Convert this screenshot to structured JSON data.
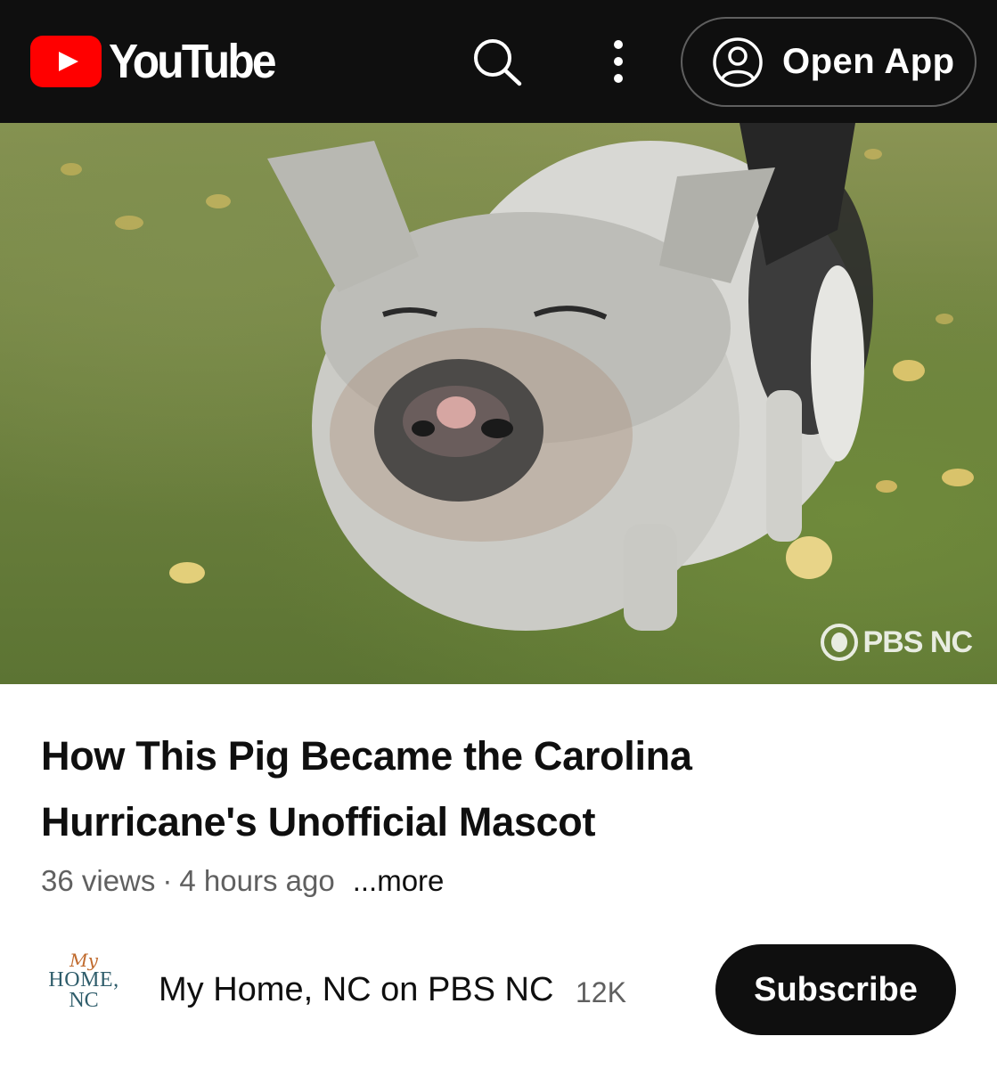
{
  "header": {
    "logo_text": "YouTube",
    "open_app_label": "Open App",
    "icons": {
      "logo": "youtube-play-icon",
      "search": "search-icon",
      "more": "more-vert-icon",
      "account": "account-circle-icon"
    }
  },
  "video": {
    "thumbnail_description_icon": "video-thumbnail",
    "watermark": "PBS NC",
    "title": "How This Pig Became the Carolina Hurricane's Unofficial Mascot",
    "views": "36 views",
    "separator": "·",
    "age": "4 hours ago",
    "more_label": "...more"
  },
  "channel": {
    "avatar_line1": "My",
    "avatar_line2": "HOME,",
    "avatar_line3": "NC",
    "name": "My Home, NC on PBS NC",
    "subscriber_count": "12K",
    "subscribe_label": "Subscribe"
  },
  "colors": {
    "topbar_bg": "#0f0f0f",
    "brand_red": "#ff0000",
    "text_primary": "#0f0f0f",
    "text_secondary": "#606060",
    "button_dark": "#0f0f0f"
  }
}
